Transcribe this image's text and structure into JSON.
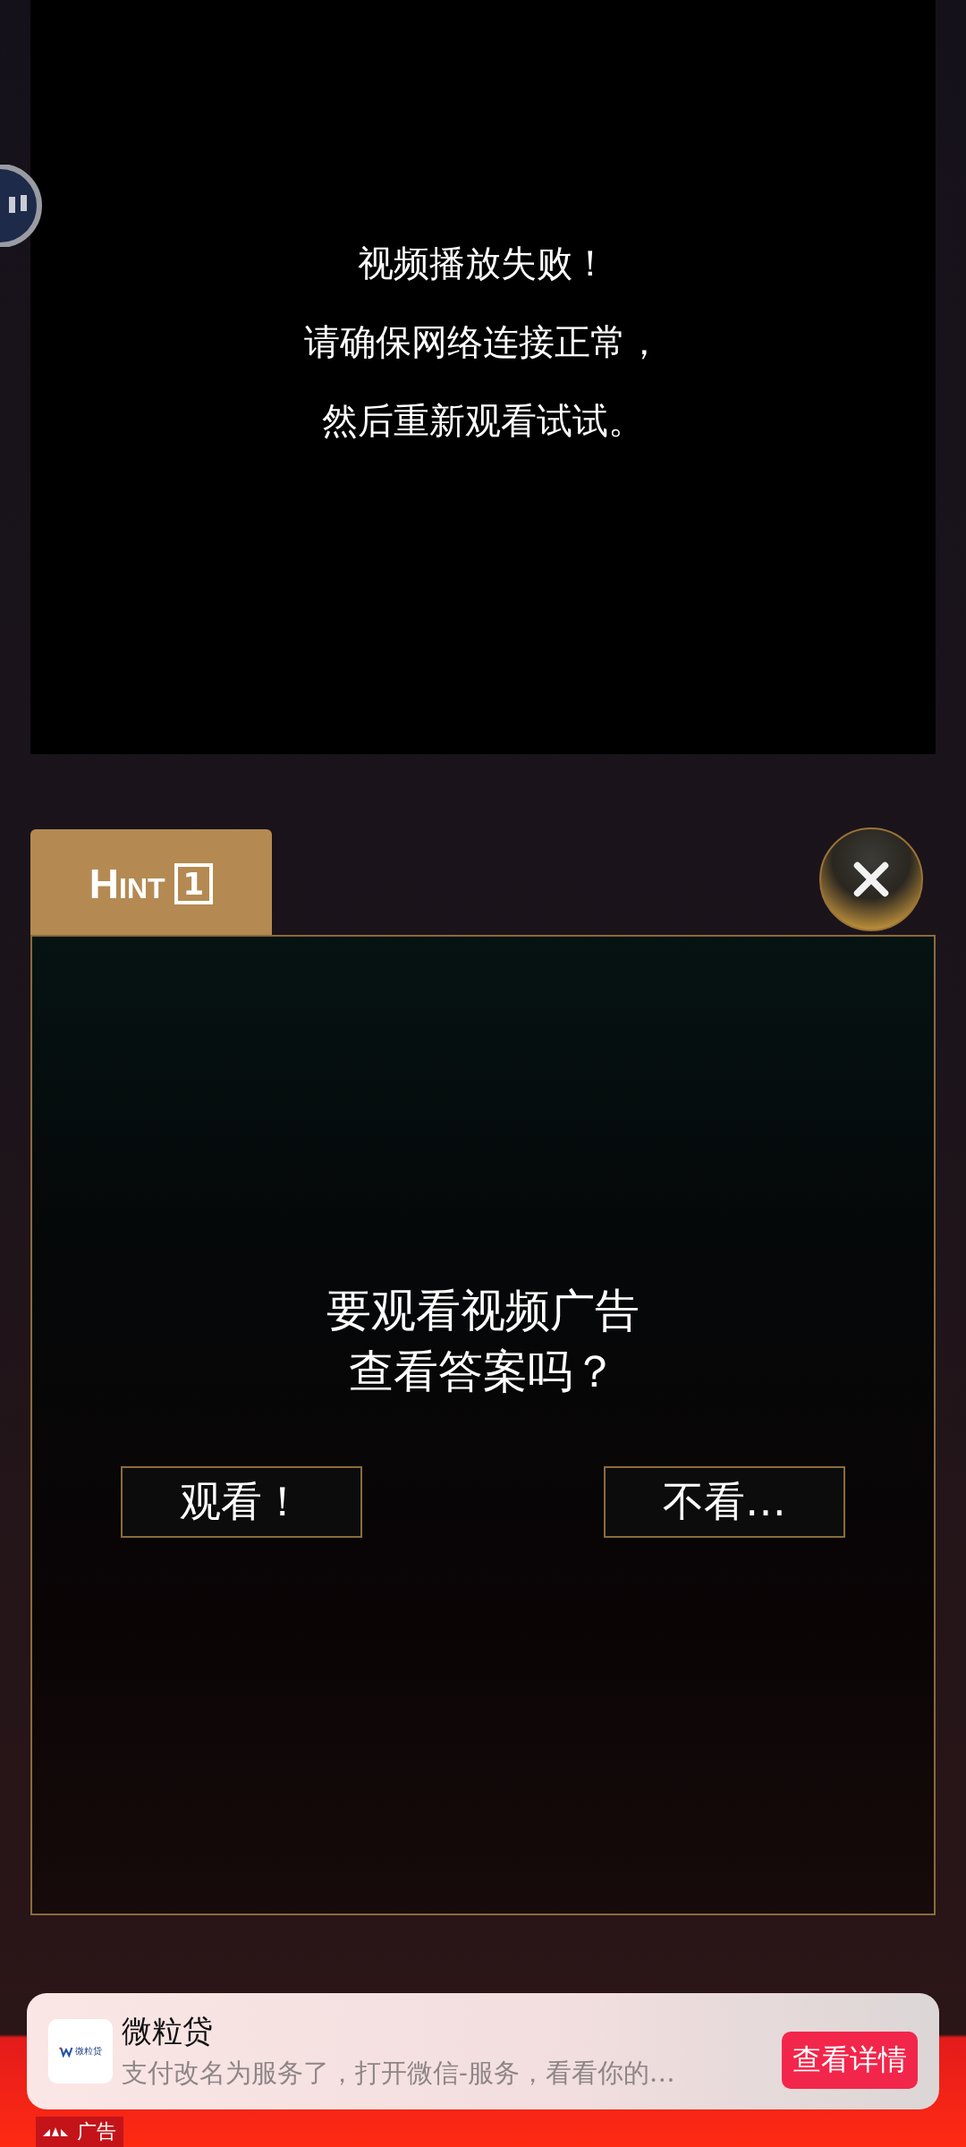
{
  "video": {
    "error_lines": [
      "视频播放失败！",
      "请确保网络连接正常，",
      "然后重新观看试试。"
    ]
  },
  "hint_tab": {
    "label": "Hint",
    "number": "1"
  },
  "dialog": {
    "question_lines": [
      "要观看视频广告",
      "查看答案吗？"
    ],
    "buttons": [
      "观看！",
      "不看…"
    ]
  },
  "ad": {
    "logo_text": "微粒贷",
    "title": "微粒贷",
    "description": "支付改名为服务了，打开微信-服务，看看你的…",
    "action": "查看详情",
    "label": "广告"
  }
}
